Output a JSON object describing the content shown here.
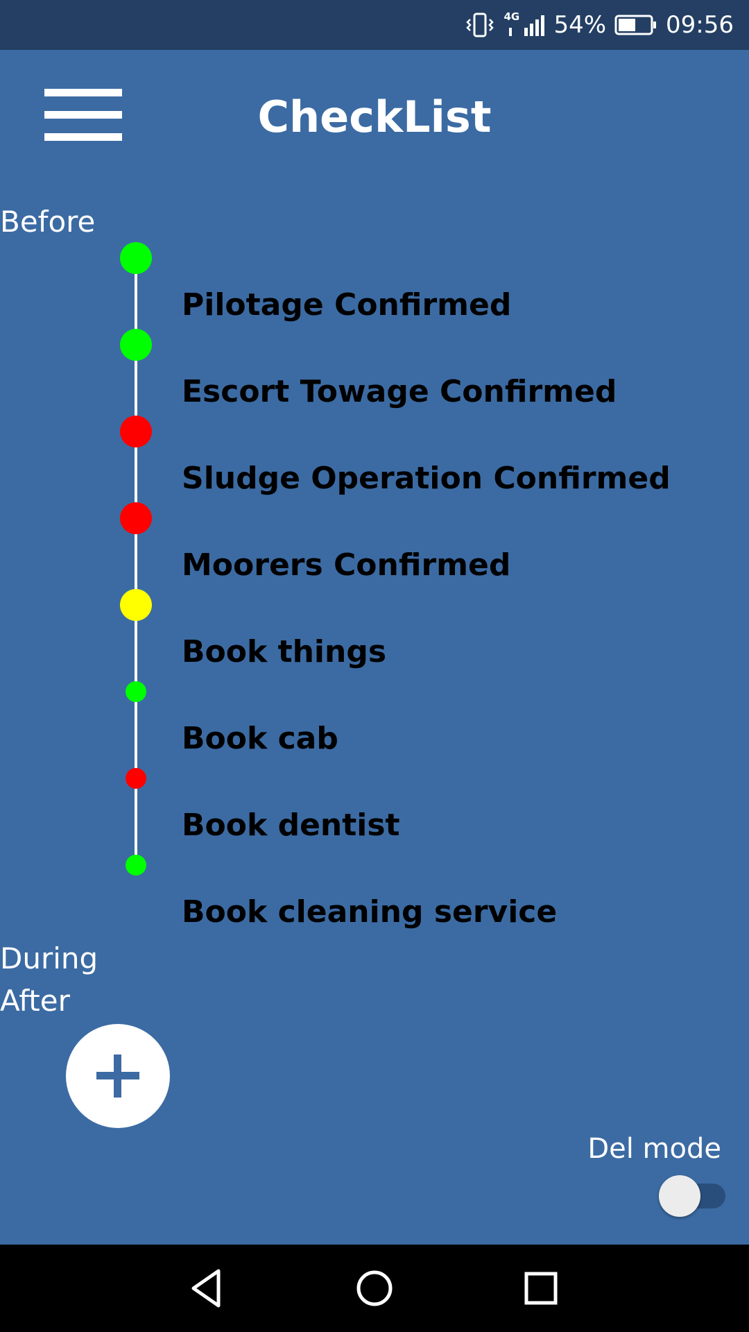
{
  "status_bar": {
    "network": "4G",
    "battery_percent": "54%",
    "time": "09:56",
    "battery_level": 0.54
  },
  "header": {
    "title": "CheckList",
    "menu_icon": "hamburger-menu-icon"
  },
  "sections": {
    "before": "Before",
    "during": "During",
    "after": "After"
  },
  "checklist": {
    "items": [
      {
        "label": "Pilotage Confirmed",
        "status_color": "#00ff00"
      },
      {
        "label": "Escort Towage Confirmed",
        "status_color": "#00ff00"
      },
      {
        "label": "Sludge Operation Confirmed",
        "status_color": "#ff0000"
      },
      {
        "label": "Moorers Confirmed",
        "status_color": "#ff0000"
      },
      {
        "label": "Book things",
        "status_color": "#ffff00"
      },
      {
        "label": "Book cab",
        "status_color": "#00ff00"
      },
      {
        "label": "Book dentist",
        "status_color": "#ff0000"
      },
      {
        "label": "Book cleaning service",
        "status_color": "#00ff00"
      }
    ]
  },
  "fab": {
    "icon": "plus-icon"
  },
  "del_mode": {
    "label": "Del mode",
    "enabled": false
  },
  "colors": {
    "background": "#3c6ba3",
    "status_bar": "#243f63",
    "nav_bar": "#000000"
  },
  "nav_bar": {
    "back_icon": "back-triangle-icon",
    "home_icon": "home-circle-icon",
    "recents_icon": "recents-square-icon"
  }
}
